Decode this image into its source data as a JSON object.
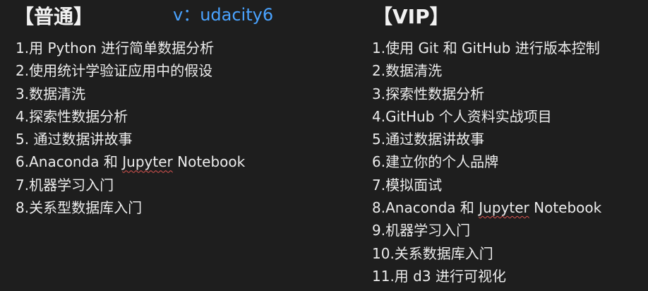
{
  "contact": "v：udacity6",
  "regular": {
    "title": "【普通】",
    "items": [
      "1.用 Python 进行简单数据分析",
      "2.使用统计学验证应用中的假设",
      "3.数据清洗",
      "4.探索性数据分析",
      "5. 通过数据讲故事",
      "6.Anaconda 和 Jupyter Notebook",
      "7.机器学习入门",
      "8.关系型数据库入门"
    ]
  },
  "vip": {
    "title": "【VIP】",
    "items": [
      "1.使用 Git 和 GitHub 进行版本控制",
      "2.数据清洗",
      "3.探索性数据分析",
      "4.GitHub 个人资料实战项目",
      "5.通过数据讲故事",
      "6.建立你的个人品牌",
      "7.模拟面试",
      "8.Anaconda 和 Jupyter Notebook",
      "9.机器学习入门",
      "10.关系数据库入门",
      "11.用 d3 进行可视化"
    ]
  }
}
